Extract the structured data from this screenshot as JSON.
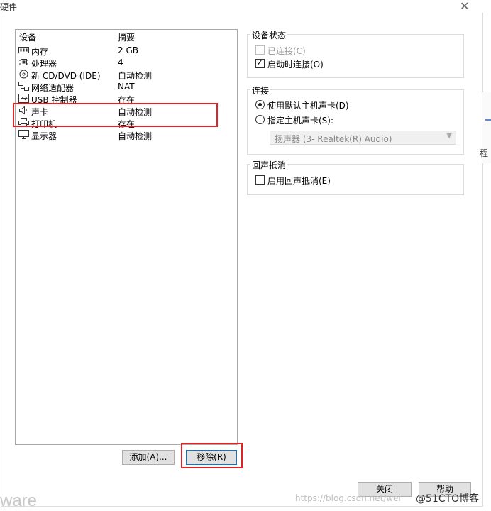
{
  "window": {
    "title": "硬件",
    "close_glyph": "✕"
  },
  "device_list": {
    "columns": {
      "device": "设备",
      "summary": "摘要"
    },
    "rows": [
      {
        "icon": "memory-icon",
        "device": "内存",
        "summary": "2 GB"
      },
      {
        "icon": "processor-icon",
        "device": "处理器",
        "summary": "4"
      },
      {
        "icon": "cd-dvd-icon",
        "device": "新 CD/DVD (IDE)",
        "summary": "自动检测"
      },
      {
        "icon": "network-adapter-icon",
        "device": "网络适配器",
        "summary": "NAT"
      },
      {
        "icon": "usb-controller-icon",
        "device": "USB 控制器",
        "summary": "存在"
      },
      {
        "icon": "sound-card-icon",
        "device": "声卡",
        "summary": "自动检测"
      },
      {
        "icon": "printer-icon",
        "device": "打印机",
        "summary": "存在"
      },
      {
        "icon": "display-icon",
        "device": "显示器",
        "summary": "自动检测"
      }
    ]
  },
  "device_status": {
    "title": "设备状态",
    "connected": {
      "label": "已连接(C)",
      "checked": false,
      "enabled": false
    },
    "connect_at_power_on": {
      "label": "启动时连接(O)",
      "checked": true
    }
  },
  "connection": {
    "title": "连接",
    "use_default": {
      "label": "使用默认主机声卡(D)",
      "selected": true
    },
    "specify": {
      "label": "指定主机声卡(S):",
      "selected": false
    },
    "host_card_value": "扬声器 (3- Realtek(R) Audio)"
  },
  "echo_cancel": {
    "title": "回声抵消",
    "enable": {
      "label": "启用回声抵消(E)",
      "checked": false
    }
  },
  "buttons": {
    "add": "添加(A)...",
    "remove": "移除(R)",
    "close": "关闭",
    "help": "帮助"
  },
  "background": {
    "side_text": "程",
    "ware_text": "ware"
  },
  "watermark": {
    "url": "https://blog.csdn.net/wei",
    "brand": "@51CTO博客"
  },
  "colors": {
    "highlight": "#e02424",
    "focus_border": "#0078d7"
  }
}
